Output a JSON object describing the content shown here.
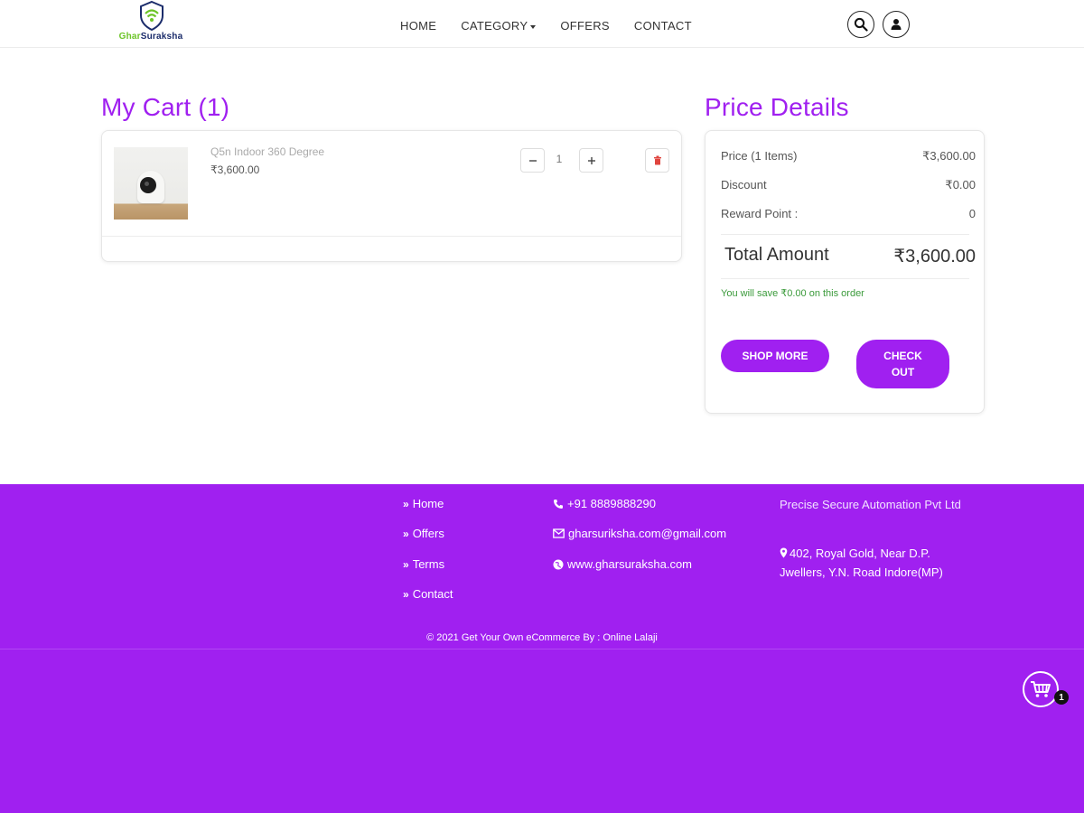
{
  "brand": {
    "name_part1": "Ghar",
    "name_part2": "Suraksha"
  },
  "nav": {
    "home": "HOME",
    "category": "CATEGORY",
    "offers": "OFFERS",
    "contact": "CONTACT"
  },
  "header_icons": [
    "search-icon",
    "user-icon"
  ],
  "cart": {
    "title": "My Cart (1)",
    "item": {
      "name": "Q5n Indoor 360 Degree",
      "price": "₹3,600.00",
      "quantity": "1"
    }
  },
  "price_details": {
    "title": "Price Details",
    "rows": [
      {
        "label": "Price (1 Items)",
        "value": "₹3,600.00"
      },
      {
        "label": "Discount",
        "value": "₹0.00"
      },
      {
        "label": "Reward Point :",
        "value": "0"
      }
    ],
    "total_label": "Total Amount",
    "total_value": "₹3,600.00",
    "savings_note": "You will save ₹0.00 on this order",
    "shop_more_label": "SHOP MORE",
    "checkout_label": "CHECK OUT"
  },
  "footer": {
    "links": [
      "Home",
      "Offers",
      "Terms",
      "Contact"
    ],
    "phone": "+91 8889888290",
    "email": "gharsuriksha.com@gmail.com",
    "website": "www.gharsuraksha.com",
    "company": "Precise Secure Automation Pvt Ltd",
    "address": "402, Royal Gold, Near D.P. Jwellers, Y.N. Road Indore(MP)",
    "copyright": "2021 Get Your Own eCommerce By : Online Lalaji"
  },
  "floating_cart": {
    "count": "1"
  },
  "colors": {
    "accent": "#a020f0",
    "logo_green": "#6cc427",
    "logo_navy": "#1b2c6b",
    "savings_green": "#3a9a3a"
  }
}
